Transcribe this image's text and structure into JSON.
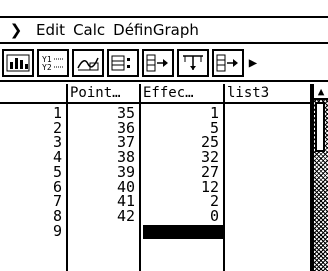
{
  "menubar": {
    "items": [
      "Edit",
      "Calc",
      "DéfinGraph"
    ]
  },
  "toolbar": {
    "icons": [
      "stat-graph-icon",
      "list-calc-icon",
      "graph-icon",
      "calc-toggle-icon",
      "insert-column-icon",
      "sort-icon",
      "add-row-icon"
    ],
    "overflow": "▶"
  },
  "table": {
    "headers": [
      "Point…",
      "Effec…",
      "list3"
    ],
    "rows": [
      {
        "index": "1",
        "a": "35",
        "b": "1"
      },
      {
        "index": "2",
        "a": "36",
        "b": "5"
      },
      {
        "index": "3",
        "a": "37",
        "b": "25"
      },
      {
        "index": "4",
        "a": "38",
        "b": "32"
      },
      {
        "index": "5",
        "a": "39",
        "b": "27"
      },
      {
        "index": "6",
        "a": "40",
        "b": "12"
      },
      {
        "index": "7",
        "a": "41",
        "b": "2"
      },
      {
        "index": "8",
        "a": "42",
        "b": "0"
      },
      {
        "index": "9",
        "a": "",
        "b": ""
      }
    ]
  },
  "scrollbar": {
    "up_arrow": "▲"
  }
}
